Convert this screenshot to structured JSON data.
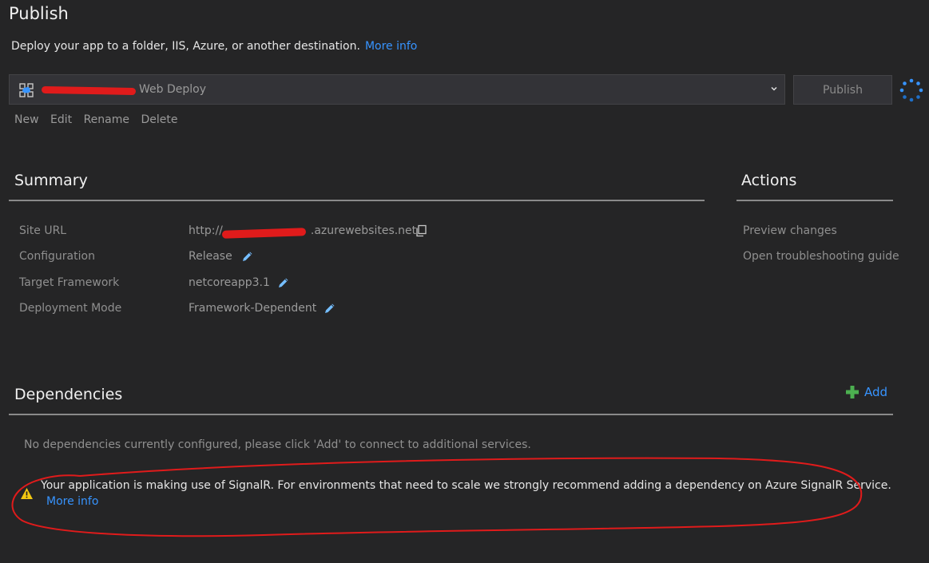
{
  "header": {
    "title": "Publish",
    "subtitle": "Deploy your app to a folder, IIS, Azure, or another destination.",
    "more_info": "More info"
  },
  "profile": {
    "label": "Web Deploy",
    "publish_button": "Publish",
    "actions": [
      "New",
      "Edit",
      "Rename",
      "Delete"
    ]
  },
  "summary": {
    "title": "Summary",
    "rows": [
      {
        "label": "Site URL",
        "value_prefix": "http://",
        "value_suffix": ".azurewebsites.net"
      },
      {
        "label": "Configuration",
        "value": "Release"
      },
      {
        "label": "Target Framework",
        "value": "netcoreapp3.1"
      },
      {
        "label": "Deployment Mode",
        "value": "Framework-Dependent"
      }
    ]
  },
  "actions": {
    "title": "Actions",
    "items": [
      "Preview changes",
      "Open troubleshooting guide"
    ]
  },
  "dependencies": {
    "title": "Dependencies",
    "add_label": "Add",
    "empty_message": "No dependencies currently configured, please click 'Add' to connect to additional services.",
    "warning_text": "Your application is making use of SignalR. For environments that need to scale we strongly recommend adding a dependency on Azure SignalR Service.",
    "warning_link": "More info"
  },
  "colors": {
    "background": "#252526",
    "link": "#3794ff",
    "annotation_red": "#e01b1b",
    "warning_yellow": "#f2c811",
    "add_green": "#4caf50",
    "edit_blue": "#75beff"
  },
  "icons": {
    "profile": "cloud-publish-icon",
    "dropdown": "chevron-down-icon",
    "spinner": "loading-spinner-icon",
    "copy": "copy-icon",
    "edit": "pencil-icon",
    "add": "plus-icon",
    "warning": "warning-icon"
  }
}
